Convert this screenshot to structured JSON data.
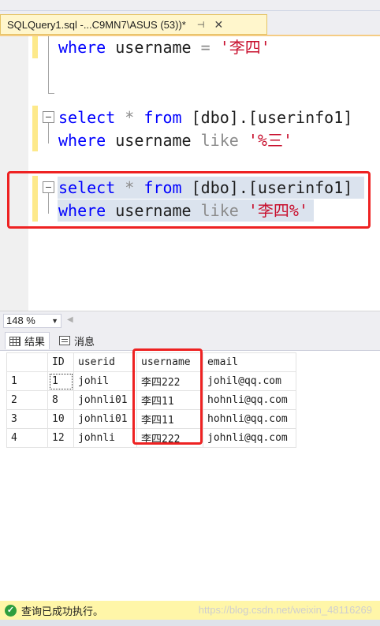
{
  "tab": {
    "title": "SQLQuery1.sql -...C9MN7\\ASUS (53))*",
    "pin_glyph": "⊣",
    "close_glyph": "✕"
  },
  "editor": {
    "line1": {
      "kw_where": "where",
      "ident": "username",
      "op": "=",
      "str": "'李四'"
    },
    "block2": {
      "kw_select": "select",
      "star": "*",
      "kw_from": "from",
      "obj": "[dbo].[userinfo1]",
      "kw_where": "where",
      "ident": "username",
      "op_like": "like",
      "str": "'%三'"
    },
    "block3": {
      "kw_select": "select",
      "star": "*",
      "kw_from": "from",
      "obj": "[dbo].[userinfo1]",
      "kw_where": "where",
      "ident": "username",
      "op_like": "like",
      "str": "'李四%'"
    }
  },
  "zoom": {
    "value": "148 %"
  },
  "results_tabs": [
    {
      "label": "结果",
      "icon": "grid-icon"
    },
    {
      "label": "消息",
      "icon": "message-icon"
    }
  ],
  "grid": {
    "columns": [
      "",
      "ID",
      "userid",
      "username",
      "email"
    ],
    "rows": [
      [
        "1",
        "1",
        "johil",
        "李四222",
        "johil@qq.com"
      ],
      [
        "2",
        "8",
        "johnli01",
        "李四11",
        "hohnli@qq.com"
      ],
      [
        "3",
        "10",
        "johnli01",
        "李四11",
        "hohnli@qq.com"
      ],
      [
        "4",
        "12",
        "johnli",
        "李四222",
        "johnli@qq.com"
      ]
    ]
  },
  "status": {
    "text": "查询已成功执行。",
    "watermark": "https://blog.csdn.net/weixin_48116269"
  },
  "colors": {
    "keyword": "#0000ff",
    "string": "#c8102e",
    "operator": "#8c8c8c",
    "highlight_box": "#ee2222",
    "status_bar": "#fff6a8"
  }
}
